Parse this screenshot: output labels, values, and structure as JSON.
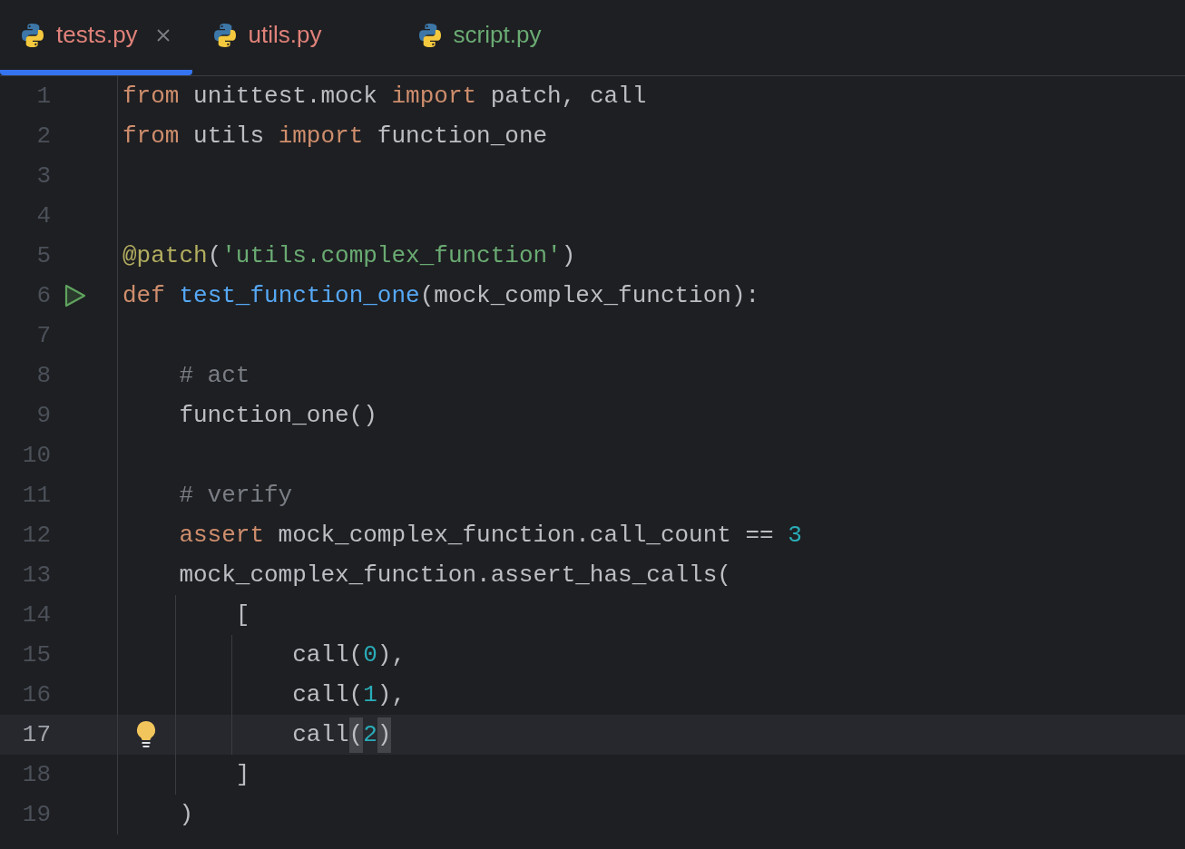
{
  "tabs": [
    {
      "label": "tests.py",
      "selected": true,
      "color": "#e0827a"
    },
    {
      "label": "utils.py",
      "selected": false,
      "color": "#e0827a"
    },
    {
      "label": "script.py",
      "selected": false,
      "color": "#6aab73"
    }
  ],
  "editor": {
    "lines": [
      {
        "number": "1",
        "current": false,
        "run": false,
        "bulb": false,
        "tokens": [
          {
            "kind": "keyword",
            "text": "from"
          },
          {
            "kind": "plain",
            "text": " unittest.mock "
          },
          {
            "kind": "keyword",
            "text": "import"
          },
          {
            "kind": "plain",
            "text": " patch, call"
          }
        ]
      },
      {
        "number": "2",
        "current": false,
        "run": false,
        "bulb": false,
        "tokens": [
          {
            "kind": "keyword",
            "text": "from"
          },
          {
            "kind": "plain",
            "text": " utils "
          },
          {
            "kind": "keyword",
            "text": "import"
          },
          {
            "kind": "plain",
            "text": " function_one"
          }
        ]
      },
      {
        "number": "3",
        "current": false,
        "run": false,
        "bulb": false
      },
      {
        "number": "4",
        "current": false,
        "run": false,
        "bulb": false
      },
      {
        "number": "5",
        "current": false,
        "run": false,
        "bulb": false,
        "tokens": [
          {
            "kind": "decorator",
            "text": "@patch"
          },
          {
            "kind": "plain",
            "text": "("
          },
          {
            "kind": "string",
            "text": "'utils.complex_function'"
          },
          {
            "kind": "plain",
            "text": ")"
          }
        ]
      },
      {
        "number": "6",
        "current": false,
        "run": true,
        "bulb": false,
        "tokens": [
          {
            "kind": "keyword",
            "text": "def "
          },
          {
            "kind": "function",
            "text": "test_function_one"
          },
          {
            "kind": "plain",
            "text": "(mock_complex_function):"
          }
        ],
        "children": [
          {
            "number": "7",
            "current": false,
            "run": false,
            "bulb": false
          },
          {
            "number": "8",
            "current": false,
            "run": false,
            "bulb": false,
            "tokens": [
              {
                "kind": "comment",
                "text": "# act"
              }
            ]
          },
          {
            "number": "9",
            "current": false,
            "run": false,
            "bulb": false,
            "tokens": [
              {
                "kind": "plain",
                "text": "function_one()"
              }
            ]
          },
          {
            "number": "10",
            "current": false,
            "run": false,
            "bulb": false
          },
          {
            "number": "11",
            "current": false,
            "run": false,
            "bulb": false,
            "tokens": [
              {
                "kind": "comment",
                "text": "# verify"
              }
            ]
          },
          {
            "number": "12",
            "current": false,
            "run": false,
            "bulb": false,
            "tokens": [
              {
                "kind": "keyword",
                "text": "assert"
              },
              {
                "kind": "plain",
                "text": " mock_complex_function.call_count == "
              },
              {
                "kind": "number",
                "text": "3"
              }
            ]
          },
          {
            "number": "13",
            "current": false,
            "run": false,
            "bulb": false,
            "tokens": [
              {
                "kind": "plain",
                "text": "mock_complex_function.assert_has_calls("
              }
            ],
            "children": [
              {
                "number": "14",
                "current": false,
                "run": false,
                "bulb": false,
                "tokens": [
                  {
                    "kind": "plain",
                    "text": "["
                  }
                ],
                "children": [
                  {
                    "number": "15",
                    "current": false,
                    "run": false,
                    "bulb": false,
                    "tokens": [
                      {
                        "kind": "plain",
                        "text": "call("
                      },
                      {
                        "kind": "number",
                        "text": "0"
                      },
                      {
                        "kind": "plain",
                        "text": "),"
                      }
                    ]
                  },
                  {
                    "number": "16",
                    "current": false,
                    "run": false,
                    "bulb": false,
                    "tokens": [
                      {
                        "kind": "plain",
                        "text": "call("
                      },
                      {
                        "kind": "number",
                        "text": "1"
                      },
                      {
                        "kind": "plain",
                        "text": "),"
                      }
                    ]
                  },
                  {
                    "number": "17",
                    "current": true,
                    "run": false,
                    "bulb": true,
                    "tokens": [
                      {
                        "kind": "plain",
                        "text": "call"
                      },
                      {
                        "kind": "bracket_match",
                        "text": "("
                      },
                      {
                        "kind": "number",
                        "text": "2"
                      },
                      {
                        "kind": "bracket_match",
                        "text": ")"
                      }
                    ]
                  }
                ]
              },
              {
                "number": "18",
                "current": false,
                "run": false,
                "bulb": false,
                "tokens": [
                  {
                    "kind": "plain",
                    "text": "]"
                  }
                ]
              }
            ]
          },
          {
            "number": "19",
            "current": false,
            "run": false,
            "bulb": false,
            "tokens": [
              {
                "kind": "plain",
                "text": ")"
              }
            ]
          }
        ]
      }
    ]
  }
}
